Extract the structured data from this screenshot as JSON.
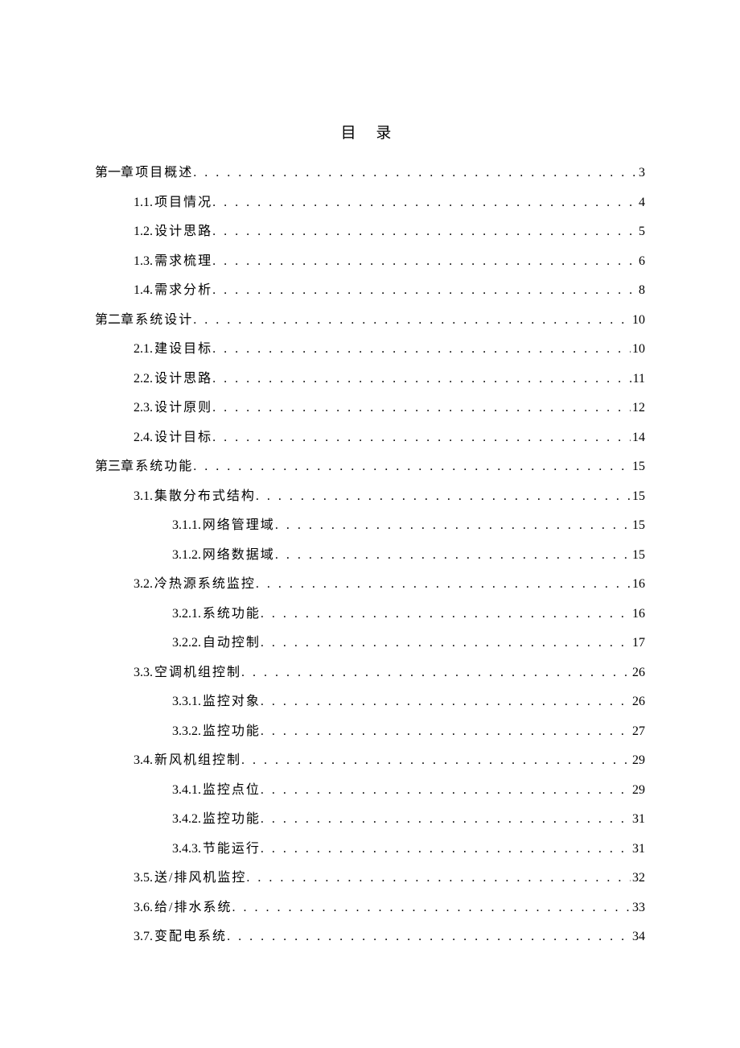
{
  "title": "目 录",
  "entries": [
    {
      "level": 1,
      "num": "第一章",
      "label": "项目概述",
      "page": "3"
    },
    {
      "level": 2,
      "num": "1.1.",
      "label": "项目情况",
      "page": "4"
    },
    {
      "level": 2,
      "num": "1.2.",
      "label": "设计思路",
      "page": "5"
    },
    {
      "level": 2,
      "num": "1.3.",
      "label": "需求梳理",
      "page": "6"
    },
    {
      "level": 2,
      "num": "1.4.",
      "label": "需求分析",
      "page": "8"
    },
    {
      "level": 1,
      "num": "第二章",
      "label": "系统设计",
      "page": "10"
    },
    {
      "level": 2,
      "num": "2.1.",
      "label": "建设目标",
      "page": "10"
    },
    {
      "level": 2,
      "num": "2.2.",
      "label": "设计思路",
      "page": "11"
    },
    {
      "level": 2,
      "num": "2.3.",
      "label": "设计原则",
      "page": "12"
    },
    {
      "level": 2,
      "num": "2.4.",
      "label": "设计目标",
      "page": "14"
    },
    {
      "level": 1,
      "num": "第三章",
      "label": "系统功能",
      "page": "15"
    },
    {
      "level": 2,
      "num": "3.1.",
      "label": "集散分布式结构",
      "page": "15"
    },
    {
      "level": 3,
      "num": "3.1.1.",
      "label": "网络管理域",
      "page": "15"
    },
    {
      "level": 3,
      "num": "3.1.2.",
      "label": "网络数据域",
      "page": "15"
    },
    {
      "level": 2,
      "num": "3.2.",
      "label": "冷热源系统监控",
      "page": "16"
    },
    {
      "level": 3,
      "num": "3.2.1.",
      "label": "系统功能",
      "page": "16"
    },
    {
      "level": 3,
      "num": "3.2.2.",
      "label": "自动控制",
      "page": "17"
    },
    {
      "level": 2,
      "num": "3.3.",
      "label": "空调机组控制",
      "page": "26"
    },
    {
      "level": 3,
      "num": "3.3.1.",
      "label": "监控对象",
      "page": "26"
    },
    {
      "level": 3,
      "num": "3.3.2.",
      "label": "监控功能",
      "page": "27"
    },
    {
      "level": 2,
      "num": "3.4.",
      "label": "新风机组控制",
      "page": "29"
    },
    {
      "level": 3,
      "num": "3.4.1.",
      "label": "监控点位",
      "page": "29"
    },
    {
      "level": 3,
      "num": "3.4.2.",
      "label": "监控功能",
      "page": "31"
    },
    {
      "level": 3,
      "num": "3.4.3.",
      "label": "节能运行",
      "page": "31"
    },
    {
      "level": 2,
      "num": "3.5.",
      "label": "送/排风机监控",
      "page": "32"
    },
    {
      "level": 2,
      "num": "3.6.",
      "label": "给/排水系统",
      "page": "33"
    },
    {
      "level": 2,
      "num": "3.7.",
      "label": "变配电系统",
      "page": "34"
    }
  ]
}
